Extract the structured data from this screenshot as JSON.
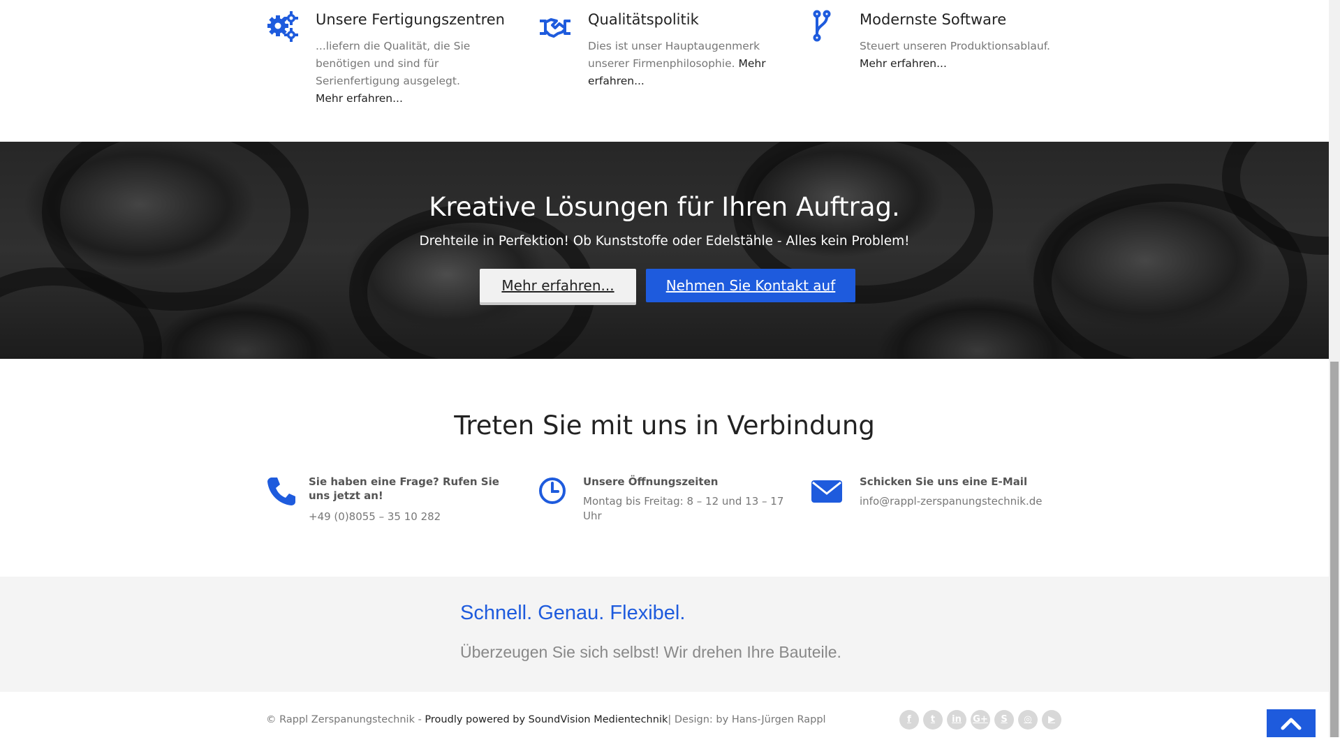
{
  "features": [
    {
      "title": "Unsere Fertigungszentren",
      "text": "...liefern die Qualität, die Sie benötigen und sind für Serienfertigung ausgelegt.",
      "link": "Mehr erfahren...",
      "icon": "gears-icon"
    },
    {
      "title": "Qualitätspolitik",
      "text": "Dies ist unser Hauptaugenmerk unserer Firmenphilosophie.",
      "link": "Mehr erfahren...",
      "icon": "handshake-icon"
    },
    {
      "title": "Modernste Software",
      "text": "Steuert unseren Produktionsablauf.",
      "link": "Mehr erfahren...",
      "icon": "code-branch-icon"
    }
  ],
  "hero": {
    "title": "Kreative Lösungen für Ihren Auftrag.",
    "subtitle": "Drehteile in Perfektion! Ob Kunststoffe oder Edelstähle - Alles kein Problem!",
    "button_more": "Mehr erfahren...",
    "button_contact": "Nehmen Sie Kontakt auf"
  },
  "contact": {
    "title": "Treten Sie mit uns in Verbindung",
    "phone": {
      "title": "Sie haben eine Frage? Rufen Sie uns jetzt an!",
      "text": "+49 (0)8055 – 35 10 282",
      "icon": "phone-icon"
    },
    "hours": {
      "title": "Unsere Öffnungszeiten",
      "text": "Montag bis Freitag: 8 – 12 und 13 – 17 Uhr",
      "icon": "clock-icon"
    },
    "email": {
      "title": "Schicken Sie uns eine E-Mail",
      "text": "info@rappl-zerspanungstechnik.de",
      "icon": "envelope-icon"
    }
  },
  "slogan": {
    "headline": "Schnell. Genau. Flexibel.",
    "text": "Überzeugen Sie sich selbst! Wir drehen Ihre Bauteile."
  },
  "footer": {
    "copyright": "© Rappl Zerspanungstechnik - ",
    "powered": "Proudly powered by SoundVision Medientechnik",
    "design": "| Design: by Hans-Jürgen Rappl",
    "social": [
      "facebook-icon",
      "twitter-icon",
      "linkedin-icon",
      "google-plus-icon",
      "skype-icon",
      "instagram-icon",
      "youtube-icon"
    ]
  },
  "colors": {
    "accent": "#1e5bdd",
    "band": "#f4f4f4"
  }
}
